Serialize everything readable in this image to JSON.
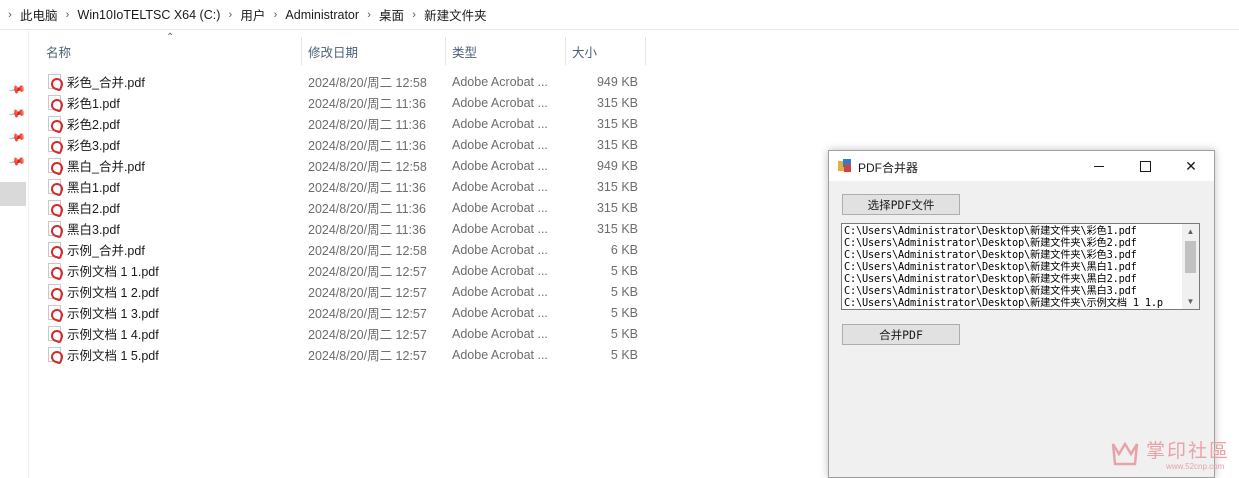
{
  "breadcrumb": {
    "items": [
      "此电脑",
      "Win10IoTELTSC X64 (C:)",
      "用户",
      "Administrator",
      "桌面",
      "新建文件夹"
    ]
  },
  "columns": {
    "name": "名称",
    "date": "修改日期",
    "type": "类型",
    "size": "大小"
  },
  "files": [
    {
      "name": "彩色_合并.pdf",
      "date": "2024/8/20/周二 12:58",
      "type": "Adobe Acrobat ...",
      "size": "949 KB"
    },
    {
      "name": "彩色1.pdf",
      "date": "2024/8/20/周二 11:36",
      "type": "Adobe Acrobat ...",
      "size": "315 KB"
    },
    {
      "name": "彩色2.pdf",
      "date": "2024/8/20/周二 11:36",
      "type": "Adobe Acrobat ...",
      "size": "315 KB"
    },
    {
      "name": "彩色3.pdf",
      "date": "2024/8/20/周二 11:36",
      "type": "Adobe Acrobat ...",
      "size": "315 KB"
    },
    {
      "name": "黑白_合并.pdf",
      "date": "2024/8/20/周二 12:58",
      "type": "Adobe Acrobat ...",
      "size": "949 KB"
    },
    {
      "name": "黑白1.pdf",
      "date": "2024/8/20/周二 11:36",
      "type": "Adobe Acrobat ...",
      "size": "315 KB"
    },
    {
      "name": "黑白2.pdf",
      "date": "2024/8/20/周二 11:36",
      "type": "Adobe Acrobat ...",
      "size": "315 KB"
    },
    {
      "name": "黑白3.pdf",
      "date": "2024/8/20/周二 11:36",
      "type": "Adobe Acrobat ...",
      "size": "315 KB"
    },
    {
      "name": "示例_合并.pdf",
      "date": "2024/8/20/周二 12:58",
      "type": "Adobe Acrobat ...",
      "size": "6 KB"
    },
    {
      "name": "示例文档 1 1.pdf",
      "date": "2024/8/20/周二 12:57",
      "type": "Adobe Acrobat ...",
      "size": "5 KB"
    },
    {
      "name": "示例文档 1 2.pdf",
      "date": "2024/8/20/周二 12:57",
      "type": "Adobe Acrobat ...",
      "size": "5 KB"
    },
    {
      "name": "示例文档 1 3.pdf",
      "date": "2024/8/20/周二 12:57",
      "type": "Adobe Acrobat ...",
      "size": "5 KB"
    },
    {
      "name": "示例文档 1 4.pdf",
      "date": "2024/8/20/周二 12:57",
      "type": "Adobe Acrobat ...",
      "size": "5 KB"
    },
    {
      "name": "示例文档 1 5.pdf",
      "date": "2024/8/20/周二 12:57",
      "type": "Adobe Acrobat ...",
      "size": "5 KB"
    }
  ],
  "dialog": {
    "title": "PDF合并器",
    "select_button": "选择PDF文件",
    "merge_button": "合并PDF",
    "close_glyph": "✕",
    "selected_files": [
      "C:\\Users\\Administrator\\Desktop\\新建文件夹\\彩色1.pdf",
      "C:\\Users\\Administrator\\Desktop\\新建文件夹\\彩色2.pdf",
      "C:\\Users\\Administrator\\Desktop\\新建文件夹\\彩色3.pdf",
      "C:\\Users\\Administrator\\Desktop\\新建文件夹\\黑白1.pdf",
      "C:\\Users\\Administrator\\Desktop\\新建文件夹\\黑白2.pdf",
      "C:\\Users\\Administrator\\Desktop\\新建文件夹\\黑白3.pdf",
      "C:\\Users\\Administrator\\Desktop\\新建文件夹\\示例文档 1 1.p"
    ]
  },
  "watermark": {
    "text": "掌印社區",
    "url": "www.52cnp.com"
  },
  "colors": {
    "header_text": "#4c607a",
    "pdf_red": "#d42a2a",
    "watermark": "#e8a3a9"
  }
}
